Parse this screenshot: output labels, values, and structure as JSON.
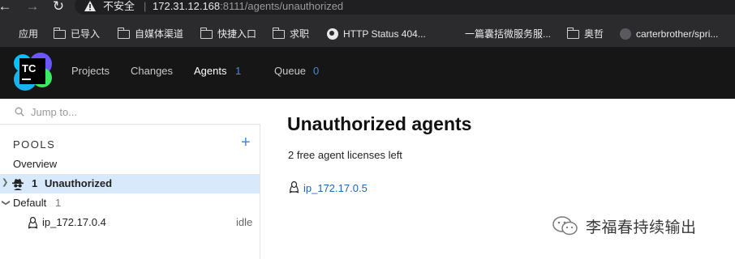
{
  "browser": {
    "insecure_label": "不安全",
    "separator": "|",
    "url_host": "172.31.12.168",
    "url_rest": ":8111/agents/unauthorized"
  },
  "bookmarks": [
    {
      "label": "应用",
      "icon": "apps-grid-icon"
    },
    {
      "label": "已导入",
      "icon": "folder-icon"
    },
    {
      "label": "自媒体渠道",
      "icon": "folder-icon"
    },
    {
      "label": "快捷入口",
      "icon": "folder-icon"
    },
    {
      "label": "求职",
      "icon": "folder-icon"
    },
    {
      "label": "HTTP Status 404...",
      "icon": "globe-icon"
    },
    {
      "label": "一篇囊括微服务服...",
      "icon": "blank-icon"
    },
    {
      "label": "奥哲",
      "icon": "folder-icon"
    },
    {
      "label": "carterbrother/spri...",
      "icon": "github-icon"
    }
  ],
  "header": {
    "logo_text": "TC",
    "nav": [
      {
        "label": "Projects",
        "count": ""
      },
      {
        "label": "Changes",
        "count": ""
      },
      {
        "label": "Agents",
        "count": "1"
      },
      {
        "label": "Queue",
        "count": "0"
      }
    ]
  },
  "sidebar": {
    "search_placeholder": "Jump to...",
    "pools_heading": "POOLS",
    "add_symbol": "+",
    "overview_label": "Overview",
    "unauthorized": {
      "count": "1",
      "label": "Unauthorized"
    },
    "default_pool": {
      "label": "Default",
      "count": "1"
    },
    "agent": {
      "name": "ip_172.17.0.4",
      "status": "idle"
    }
  },
  "main": {
    "title": "Unauthorized agents",
    "license_text": "2 free agent licenses left",
    "agent_link": "ip_172.17.0.5"
  },
  "watermark": {
    "text": "李福春持续输出"
  },
  "colors": {
    "accent": "#3f8cde",
    "link": "#2167b5",
    "header_bg": "#161616",
    "selected_row": "#d7e9fb"
  }
}
